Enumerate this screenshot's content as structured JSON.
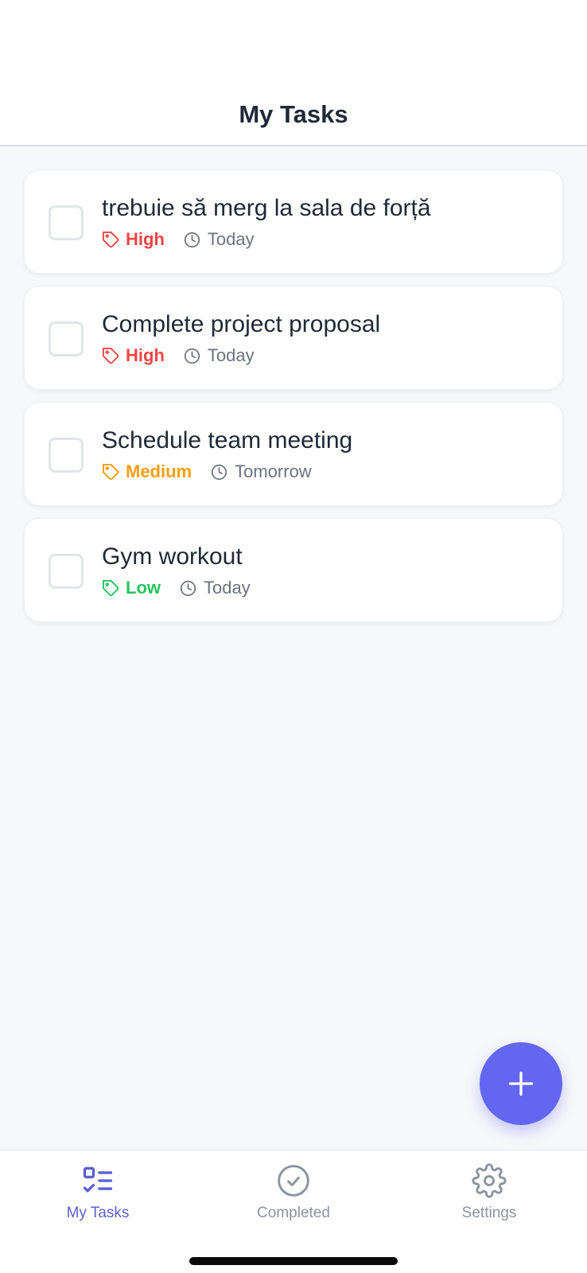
{
  "header": {
    "title": "My Tasks"
  },
  "colors": {
    "high": "#ef4444",
    "medium": "#f59e0b",
    "low": "#22c55e",
    "accent": "#6366f1",
    "muted": "#6b7280"
  },
  "tasks": [
    {
      "title": "trebuie să merg la sala de forță",
      "priority": "High",
      "priority_level": "high",
      "due": "Today",
      "completed": false
    },
    {
      "title": "Complete project proposal",
      "priority": "High",
      "priority_level": "high",
      "due": "Today",
      "completed": false
    },
    {
      "title": "Schedule team meeting",
      "priority": "Medium",
      "priority_level": "medium",
      "due": "Tomorrow",
      "completed": false
    },
    {
      "title": "Gym workout",
      "priority": "Low",
      "priority_level": "low",
      "due": "Today",
      "completed": false
    }
  ],
  "fab": {
    "icon": "plus-icon"
  },
  "tabbar": {
    "tabs": [
      {
        "label": "My Tasks",
        "icon": "task-list-icon",
        "active": true
      },
      {
        "label": "Completed",
        "icon": "check-circle-icon",
        "active": false
      },
      {
        "label": "Settings",
        "icon": "gear-icon",
        "active": false
      }
    ]
  }
}
